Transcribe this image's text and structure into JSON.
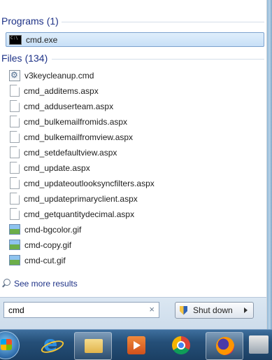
{
  "programs": {
    "header": "Programs",
    "count": "(1)",
    "items": [
      {
        "label": "cmd.exe",
        "icon": "cmd-icon"
      }
    ]
  },
  "files": {
    "header": "Files",
    "count": "(134)",
    "items": [
      {
        "label": "v3keycleanup.cmd",
        "icon": "gear-file-icon"
      },
      {
        "label": "cmd_additems.aspx",
        "icon": "document-icon"
      },
      {
        "label": "cmd_adduserteam.aspx",
        "icon": "document-icon"
      },
      {
        "label": "cmd_bulkemailfromids.aspx",
        "icon": "document-icon"
      },
      {
        "label": "cmd_bulkemailfromview.aspx",
        "icon": "document-icon"
      },
      {
        "label": "cmd_setdefaultview.aspx",
        "icon": "document-icon"
      },
      {
        "label": "cmd_update.aspx",
        "icon": "document-icon"
      },
      {
        "label": "cmd_updateoutlooksyncfilters.aspx",
        "icon": "document-icon"
      },
      {
        "label": "cmd_updateprimaryclient.aspx",
        "icon": "document-icon"
      },
      {
        "label": "cmd_getquantitydecimal.aspx",
        "icon": "document-icon"
      },
      {
        "label": "cmd-bgcolor.gif",
        "icon": "image-file-icon"
      },
      {
        "label": "cmd-copy.gif",
        "icon": "image-file-icon"
      },
      {
        "label": "cmd-cut.gif",
        "icon": "image-file-icon"
      }
    ]
  },
  "see_more": "See more results",
  "search": {
    "value": "cmd",
    "clear": "×"
  },
  "shutdown": {
    "label": "Shut down"
  },
  "taskbar": [
    "start-orb",
    "internet-explorer-icon",
    "file-explorer-icon",
    "media-player-icon",
    "chrome-icon",
    "firefox-icon",
    "pinned-app-icon"
  ],
  "colors": {
    "header": "#1e3287",
    "selection": "#c8e0f7",
    "taskbar": "#254f78"
  }
}
